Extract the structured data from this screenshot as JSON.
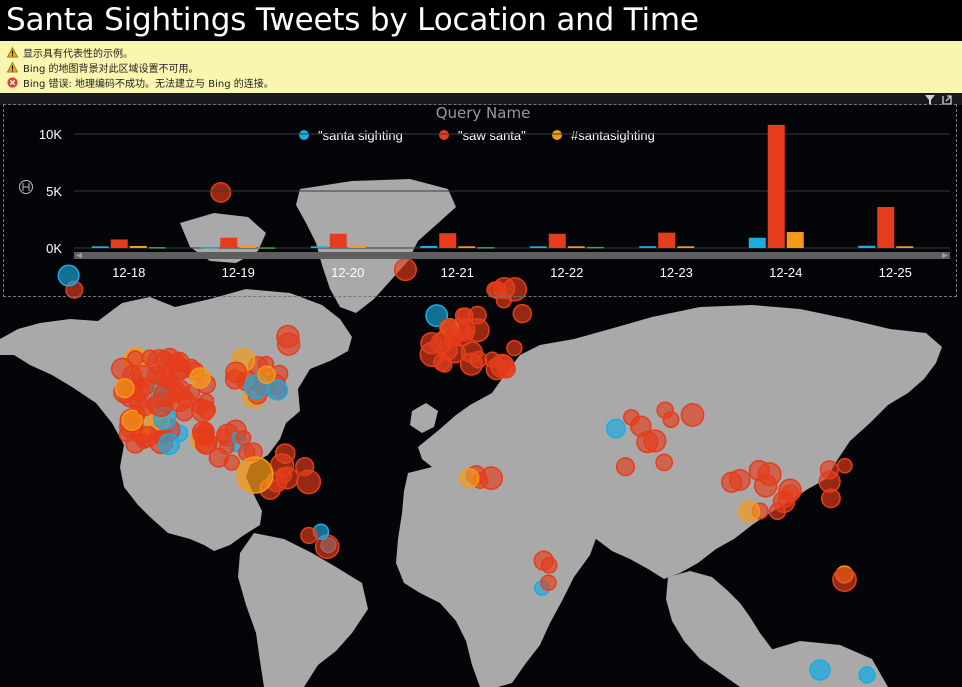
{
  "title": "Santa Sightings Tweets by Location and Time",
  "warnings": [
    {
      "type": "warning",
      "text": "显示具有代表性的示例。"
    },
    {
      "type": "warning",
      "text": "Bing 的地图背景对此区域设置不可用。"
    },
    {
      "type": "error",
      "text": "Bing 错误: 地理编码不成功。无法建立与 Bing 的连接。"
    }
  ],
  "icons": {
    "filter": "filter-icon",
    "focus": "focus-mode-icon",
    "axis_toggle": "axis-toggle-icon"
  },
  "colors": {
    "santa_sighting": "#1AABE0",
    "saw_santa": "#E53D1B",
    "santasighting_hashtag": "#F59A18",
    "fourth_series": "#3CA94E",
    "land": "#A9A9A9",
    "ocean": "#030508",
    "warning_bg": "#FAF6AF"
  },
  "chart_data": {
    "type": "bar",
    "title": "",
    "legend_title": "Query Name",
    "legend_placement": "top-center",
    "ylim": [
      0,
      10500
    ],
    "y_ticks": [
      0,
      5000,
      10000
    ],
    "y_tick_labels": [
      "0K",
      "5K",
      "10K"
    ],
    "categories": [
      "12-18",
      "12-19",
      "12-20",
      "12-21",
      "12-22",
      "12-23",
      "12-24",
      "12-25"
    ],
    "series": [
      {
        "name": "\"santa sighting",
        "color": "#1AABE0",
        "values": [
          150,
          100,
          150,
          180,
          150,
          160,
          900,
          200
        ]
      },
      {
        "name": "\"saw santa\"",
        "color": "#E53D1B",
        "values": [
          750,
          900,
          1250,
          1300,
          1250,
          1350,
          10800,
          3600
        ]
      },
      {
        "name": "#santasighting",
        "color": "#F59A18",
        "values": [
          180,
          200,
          180,
          150,
          150,
          150,
          1400,
          150
        ]
      },
      {
        "color": "#3CA94E",
        "values": [
          80,
          60,
          0,
          80,
          100,
          0,
          0,
          0
        ]
      }
    ],
    "grid": true,
    "scrollbar": true
  },
  "map_bubbles": [
    {
      "lon": -98,
      "lat": 37,
      "sizes": 9,
      "series": "saw_santa"
    }
  ]
}
